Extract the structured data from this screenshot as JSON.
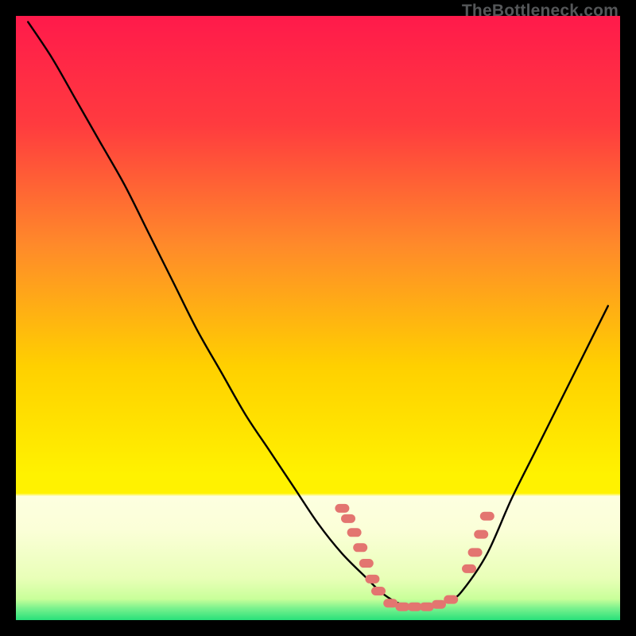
{
  "watermark": "TheBottleneck.com",
  "chart_data": {
    "type": "line",
    "title": "",
    "xlabel": "",
    "ylabel": "",
    "xlim": [
      0,
      100
    ],
    "ylim": [
      0,
      100
    ],
    "background_gradient": {
      "top": "#ff1a4b",
      "mid1": "#ff6a2a",
      "mid2": "#ffd400",
      "mid3": "#fff200",
      "bottom_band": "#f7ffd0",
      "bottom": "#28e07a"
    },
    "curve": {
      "name": "bottleneck-curve",
      "color": "#000000",
      "x": [
        2,
        6,
        10,
        14,
        18,
        22,
        26,
        30,
        34,
        38,
        42,
        46,
        50,
        54,
        58,
        60,
        62,
        64,
        68,
        72,
        74,
        78,
        82,
        86,
        90,
        94,
        98
      ],
      "y": [
        99,
        93,
        86,
        79,
        72,
        64,
        56,
        48,
        41,
        34,
        28,
        22,
        16,
        11,
        7,
        5,
        3.5,
        2.6,
        2.2,
        3.4,
        5,
        11,
        20,
        28,
        36,
        44,
        52
      ]
    },
    "highlight_markers": {
      "name": "sweet-spot-markers",
      "color": "#e37570",
      "shape": "rounded-dash",
      "points": [
        {
          "x": 54,
          "y": 18.5
        },
        {
          "x": 55,
          "y": 16.8
        },
        {
          "x": 56,
          "y": 14.5
        },
        {
          "x": 57,
          "y": 12.0
        },
        {
          "x": 58,
          "y": 9.4
        },
        {
          "x": 59,
          "y": 6.8
        },
        {
          "x": 60,
          "y": 4.8
        },
        {
          "x": 62,
          "y": 2.8
        },
        {
          "x": 64,
          "y": 2.2
        },
        {
          "x": 66,
          "y": 2.2
        },
        {
          "x": 68,
          "y": 2.2
        },
        {
          "x": 70,
          "y": 2.6
        },
        {
          "x": 72,
          "y": 3.4
        },
        {
          "x": 75,
          "y": 8.5
        },
        {
          "x": 76,
          "y": 11.2
        },
        {
          "x": 77,
          "y": 14.2
        },
        {
          "x": 78,
          "y": 17.2
        }
      ]
    }
  }
}
